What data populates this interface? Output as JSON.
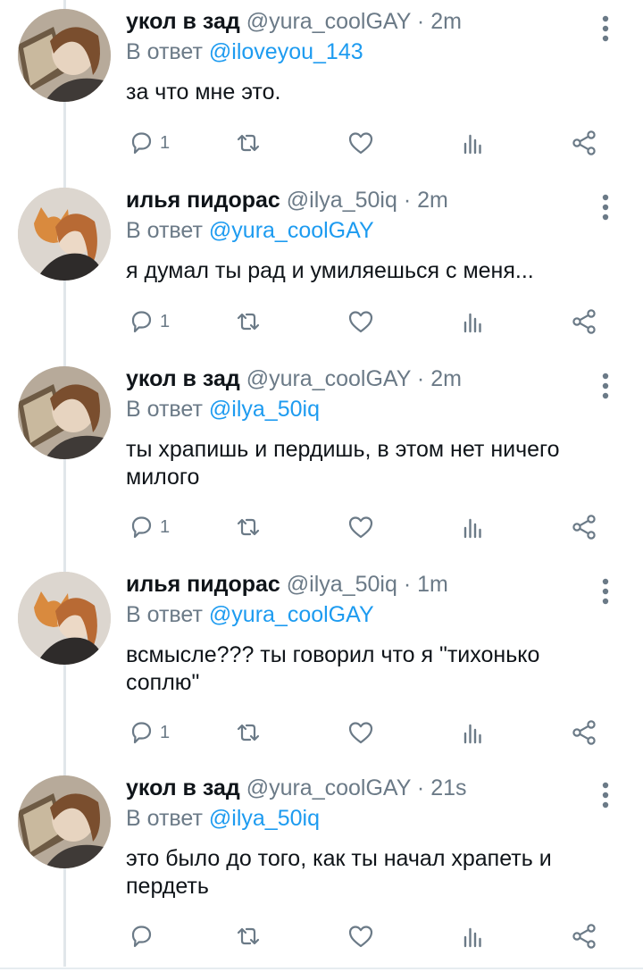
{
  "thread": {
    "reply_prefix": "В ответ",
    "tweets": [
      {
        "author": "укол в зад",
        "handle": "@yura_coolGAY",
        "separator": "·",
        "time": "2m",
        "reply_to": "@iloveyou_143",
        "text": "за что мне это.",
        "reply_count": "1",
        "avatar": "yura-avatar"
      },
      {
        "author": "илья пидорас",
        "handle": "@ilya_50iq",
        "separator": "·",
        "time": "2m",
        "reply_to": "@yura_coolGAY",
        "text": "я думал ты рад и умиляешься с меня...",
        "reply_count": "1",
        "avatar": "ilya-avatar"
      },
      {
        "author": "укол в зад",
        "handle": "@yura_coolGAY",
        "separator": "·",
        "time": "2m",
        "reply_to": "@ilya_50iq",
        "text": "ты храпишь и пердишь, в этом нет ничего милого",
        "reply_count": "1",
        "avatar": "yura-avatar"
      },
      {
        "author": "илья пидорас",
        "handle": "@ilya_50iq",
        "separator": "·",
        "time": "1m",
        "reply_to": "@yura_coolGAY",
        "text": "всмысле??? ты говорил что я \"тихонько соплю\"",
        "reply_count": "1",
        "avatar": "ilya-avatar"
      },
      {
        "author": "укол в зад",
        "handle": "@yura_coolGAY",
        "separator": "·",
        "time": "21s",
        "reply_to": "@ilya_50iq",
        "text": "это было до того, как ты начал храпеть и пердеть",
        "reply_count": "",
        "avatar": "yura-avatar"
      }
    ]
  },
  "icons": {
    "reply": "reply-icon",
    "retweet": "retweet-icon",
    "like": "heart-icon",
    "stats": "stats-icon",
    "share": "share-icon",
    "more": "more-vertical-icon"
  },
  "colors": {
    "link": "#1d9bf0",
    "secondary_text": "#6b7a87",
    "primary_text": "#0f1419",
    "thread_line": "#e1e6ea"
  }
}
